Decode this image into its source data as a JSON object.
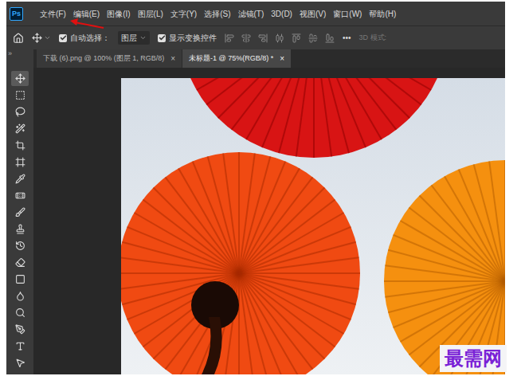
{
  "app": {
    "logo": "Ps"
  },
  "menu": [
    "文件(F)",
    "编辑(E)",
    "图像(I)",
    "图层(L)",
    "文字(Y)",
    "选择(S)",
    "滤镜(T)",
    "3D(D)",
    "视图(V)",
    "窗口(W)",
    "帮助(H)"
  ],
  "options_bar": {
    "auto_select": {
      "label": "自动选择：",
      "checked": true
    },
    "layer_select": {
      "value": "图层"
    },
    "show_transform": {
      "label": "显示变换控件",
      "checked": true
    },
    "more": "•••",
    "mode_3d": "3D 模式:"
  },
  "panel_toggle": "»",
  "tabs": [
    {
      "label": "下载 (6).png @ 100% (图层 1, RGB/8)",
      "close": "×",
      "selected": false
    },
    {
      "label": "未标题-1 @ 75%(RGB/8) *",
      "close": "×",
      "selected": true
    }
  ],
  "tools": [
    {
      "selected": true
    },
    {
      "selected": false
    },
    {
      "selected": false
    },
    {
      "selected": false
    },
    {
      "selected": false
    },
    {
      "selected": false
    },
    {
      "selected": false
    },
    {
      "selected": false
    },
    {
      "selected": false
    },
    {
      "selected": false
    },
    {
      "selected": false
    },
    {
      "selected": false
    },
    {
      "selected": false
    },
    {
      "selected": false
    },
    {
      "selected": false
    },
    {
      "selected": false
    },
    {
      "selected": false
    },
    {
      "selected": false
    }
  ],
  "watermark": "最需网"
}
